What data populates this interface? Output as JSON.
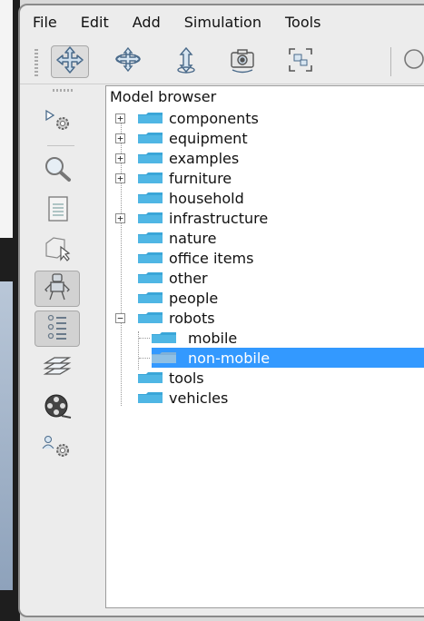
{
  "menu": {
    "file": "File",
    "edit": "Edit",
    "add": "Add",
    "simulation": "Simulation",
    "tools": "Tools"
  },
  "toolbar": {
    "buttons": [
      "move-icon",
      "rotate-icon",
      "shift-icon",
      "camera-icon",
      "fit-view-icon"
    ],
    "active": "move-icon"
  },
  "sidebar": {
    "buttons": [
      "run-settings-icon",
      "zoom-icon",
      "document-icon",
      "selection-icon",
      "robot-icon",
      "list-icon",
      "layers-icon",
      "film-icon",
      "user-settings-icon"
    ],
    "active": [
      "robot-icon",
      "list-icon"
    ]
  },
  "model_browser": {
    "title": "Model browser",
    "items": [
      {
        "label": "components",
        "expandable": true,
        "expanded": false
      },
      {
        "label": "equipment",
        "expandable": true,
        "expanded": false
      },
      {
        "label": "examples",
        "expandable": true,
        "expanded": false
      },
      {
        "label": "furniture",
        "expandable": true,
        "expanded": false
      },
      {
        "label": "household",
        "expandable": false
      },
      {
        "label": "infrastructure",
        "expandable": true,
        "expanded": false
      },
      {
        "label": "nature",
        "expandable": false
      },
      {
        "label": "office items",
        "expandable": false
      },
      {
        "label": "other",
        "expandable": false
      },
      {
        "label": "people",
        "expandable": false
      },
      {
        "label": "robots",
        "expandable": true,
        "expanded": true,
        "children": [
          {
            "label": "mobile"
          },
          {
            "label": "non-mobile",
            "selected": true
          }
        ]
      },
      {
        "label": "tools",
        "expandable": false
      },
      {
        "label": "vehicles",
        "expandable": false
      }
    ]
  },
  "colors": {
    "selection": "#3399ff",
    "folder": "#3aa6d8"
  }
}
